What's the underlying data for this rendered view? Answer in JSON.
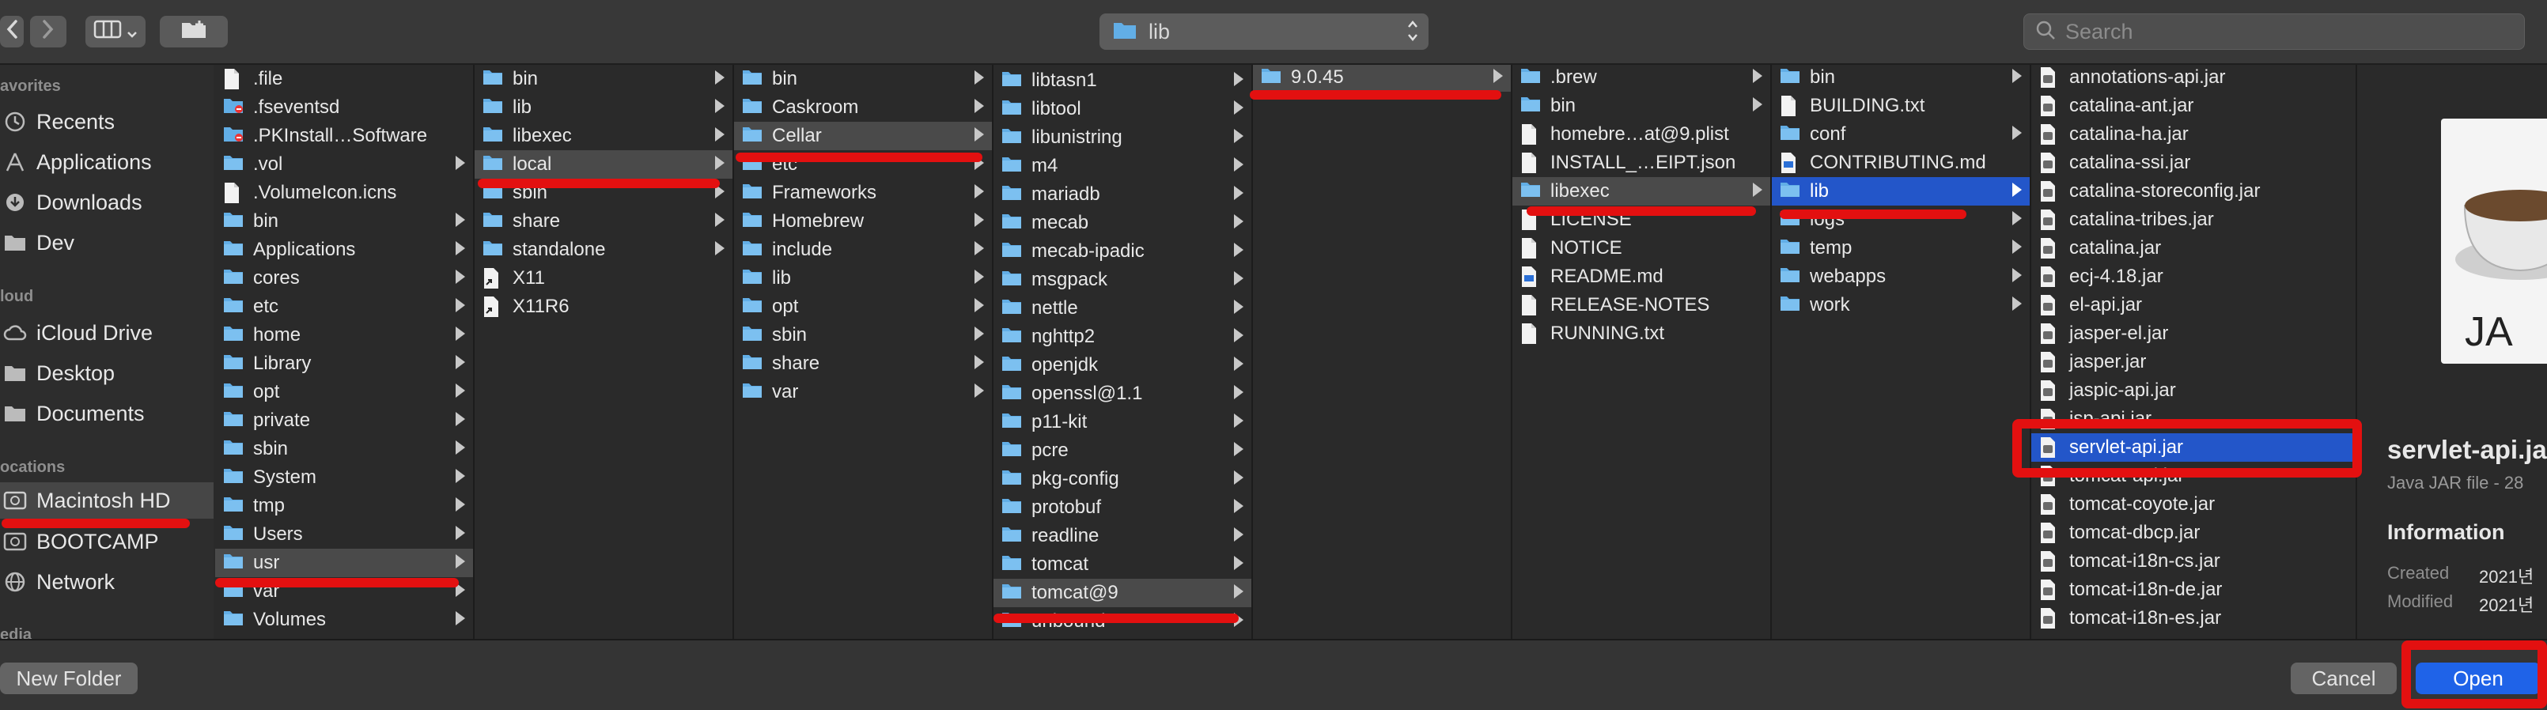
{
  "toolbar": {
    "back_icon": "chevron-left-icon",
    "forward_icon": "chevron-right-icon",
    "view_icon": "column-view-icon",
    "new_folder_icon": "new-folder-icon",
    "path_label": "lib",
    "search_placeholder": "Search"
  },
  "sidebar": {
    "sections": [
      {
        "title": "avorites",
        "items": [
          {
            "label": "Recents",
            "icon": "clock-icon"
          },
          {
            "label": "Applications",
            "icon": "applications-icon"
          },
          {
            "label": "Downloads",
            "icon": "download-icon"
          },
          {
            "label": "Dev",
            "icon": "folder-icon"
          }
        ]
      },
      {
        "title": "loud",
        "items": [
          {
            "label": "iCloud Drive",
            "icon": "cloud-icon"
          },
          {
            "label": "Desktop",
            "icon": "folder-icon"
          },
          {
            "label": "Documents",
            "icon": "document-icon"
          }
        ]
      },
      {
        "title": "ocations",
        "items": [
          {
            "label": "Macintosh HD",
            "icon": "hard-drive-icon",
            "selected": true
          },
          {
            "label": "BOOTCAMP",
            "icon": "hard-drive-icon"
          },
          {
            "label": "Network",
            "icon": "globe-icon"
          }
        ]
      },
      {
        "title": "edia",
        "items": []
      }
    ]
  },
  "columns": [
    {
      "name": "root",
      "items": [
        {
          "label": ".file",
          "type": "file"
        },
        {
          "label": ".fseventsd",
          "type": "folder-restricted"
        },
        {
          "label": ".PKInstall…Software",
          "type": "folder-restricted"
        },
        {
          "label": ".vol",
          "type": "folder",
          "expand": true
        },
        {
          "label": ".VolumeIcon.icns",
          "type": "file"
        },
        {
          "label": "bin",
          "type": "folder",
          "expand": true
        },
        {
          "label": "Applications",
          "type": "folder",
          "expand": true
        },
        {
          "label": "cores",
          "type": "folder",
          "expand": true
        },
        {
          "label": "etc",
          "type": "folder",
          "expand": true
        },
        {
          "label": "home",
          "type": "folder",
          "expand": true
        },
        {
          "label": "Library",
          "type": "folder",
          "expand": true
        },
        {
          "label": "opt",
          "type": "folder",
          "expand": true
        },
        {
          "label": "private",
          "type": "folder",
          "expand": true
        },
        {
          "label": "sbin",
          "type": "folder",
          "expand": true
        },
        {
          "label": "System",
          "type": "folder",
          "expand": true
        },
        {
          "label": "tmp",
          "type": "folder",
          "expand": true
        },
        {
          "label": "Users",
          "type": "folder",
          "expand": true
        },
        {
          "label": "usr",
          "type": "folder",
          "expand": true,
          "state": "gray"
        },
        {
          "label": "var",
          "type": "folder",
          "expand": true
        },
        {
          "label": "Volumes",
          "type": "folder",
          "expand": true
        }
      ]
    },
    {
      "name": "usr",
      "items": [
        {
          "label": "bin",
          "type": "folder",
          "expand": true
        },
        {
          "label": "lib",
          "type": "folder",
          "expand": true
        },
        {
          "label": "libexec",
          "type": "folder",
          "expand": true
        },
        {
          "label": "local",
          "type": "folder",
          "expand": true,
          "state": "gray"
        },
        {
          "label": "sbin",
          "type": "folder",
          "expand": true
        },
        {
          "label": "share",
          "type": "folder",
          "expand": true
        },
        {
          "label": "standalone",
          "type": "folder",
          "expand": true
        },
        {
          "label": "X11",
          "type": "alias"
        },
        {
          "label": "X11R6",
          "type": "alias"
        }
      ]
    },
    {
      "name": "local",
      "items": [
        {
          "label": "bin",
          "type": "folder",
          "expand": true
        },
        {
          "label": "Caskroom",
          "type": "folder",
          "expand": true
        },
        {
          "label": "Cellar",
          "type": "folder",
          "expand": true,
          "state": "gray"
        },
        {
          "label": "etc",
          "type": "folder",
          "expand": true
        },
        {
          "label": "Frameworks",
          "type": "folder",
          "expand": true
        },
        {
          "label": "Homebrew",
          "type": "folder",
          "expand": true
        },
        {
          "label": "include",
          "type": "folder",
          "expand": true
        },
        {
          "label": "lib",
          "type": "folder",
          "expand": true
        },
        {
          "label": "opt",
          "type": "folder",
          "expand": true
        },
        {
          "label": "sbin",
          "type": "folder",
          "expand": true
        },
        {
          "label": "share",
          "type": "folder",
          "expand": true
        },
        {
          "label": "var",
          "type": "folder",
          "expand": true
        }
      ]
    },
    {
      "name": "Cellar",
      "items": [
        {
          "label": "libtasn1",
          "type": "folder",
          "expand": true
        },
        {
          "label": "libtool",
          "type": "folder",
          "expand": true
        },
        {
          "label": "libunistring",
          "type": "folder",
          "expand": true
        },
        {
          "label": "m4",
          "type": "folder",
          "expand": true
        },
        {
          "label": "mariadb",
          "type": "folder",
          "expand": true
        },
        {
          "label": "mecab",
          "type": "folder",
          "expand": true
        },
        {
          "label": "mecab-ipadic",
          "type": "folder",
          "expand": true
        },
        {
          "label": "msgpack",
          "type": "folder",
          "expand": true
        },
        {
          "label": "nettle",
          "type": "folder",
          "expand": true
        },
        {
          "label": "nghttp2",
          "type": "folder",
          "expand": true
        },
        {
          "label": "openjdk",
          "type": "folder",
          "expand": true
        },
        {
          "label": "openssl@1.1",
          "type": "folder",
          "expand": true
        },
        {
          "label": "p11-kit",
          "type": "folder",
          "expand": true
        },
        {
          "label": "pcre",
          "type": "folder",
          "expand": true
        },
        {
          "label": "pkg-config",
          "type": "folder",
          "expand": true
        },
        {
          "label": "protobuf",
          "type": "folder",
          "expand": true
        },
        {
          "label": "readline",
          "type": "folder",
          "expand": true
        },
        {
          "label": "tomcat",
          "type": "folder",
          "expand": true
        },
        {
          "label": "tomcat@9",
          "type": "folder",
          "expand": true,
          "state": "gray"
        },
        {
          "label": "unbound",
          "type": "folder",
          "expand": true
        }
      ]
    },
    {
      "name": "tomcat@9",
      "items": [
        {
          "label": "9.0.45",
          "type": "folder",
          "expand": true,
          "state": "gray"
        }
      ]
    },
    {
      "name": "9.0.45",
      "items": [
        {
          "label": ".brew",
          "type": "folder",
          "expand": true
        },
        {
          "label": "bin",
          "type": "folder",
          "expand": true
        },
        {
          "label": "homebre…at@9.plist",
          "type": "file"
        },
        {
          "label": "INSTALL_…EIPT.json",
          "type": "file"
        },
        {
          "label": "libexec",
          "type": "folder",
          "expand": true,
          "state": "gray"
        },
        {
          "label": "LICENSE",
          "type": "file"
        },
        {
          "label": "NOTICE",
          "type": "file"
        },
        {
          "label": "README.md",
          "type": "file-md"
        },
        {
          "label": "RELEASE-NOTES",
          "type": "file"
        },
        {
          "label": "RUNNING.txt",
          "type": "file"
        }
      ]
    },
    {
      "name": "libexec",
      "items": [
        {
          "label": "bin",
          "type": "folder",
          "expand": true
        },
        {
          "label": "BUILDING.txt",
          "type": "file"
        },
        {
          "label": "conf",
          "type": "folder",
          "expand": true
        },
        {
          "label": "CONTRIBUTING.md",
          "type": "file-md"
        },
        {
          "label": "lib",
          "type": "folder",
          "expand": true,
          "state": "blue"
        },
        {
          "label": "logs",
          "type": "folder",
          "expand": true
        },
        {
          "label": "temp",
          "type": "folder",
          "expand": true
        },
        {
          "label": "webapps",
          "type": "folder",
          "expand": true
        },
        {
          "label": "work",
          "type": "folder",
          "expand": true
        }
      ]
    },
    {
      "name": "lib",
      "items": [
        {
          "label": "annotations-api.jar",
          "type": "jar"
        },
        {
          "label": "catalina-ant.jar",
          "type": "jar"
        },
        {
          "label": "catalina-ha.jar",
          "type": "jar"
        },
        {
          "label": "catalina-ssi.jar",
          "type": "jar"
        },
        {
          "label": "catalina-storeconfig.jar",
          "type": "jar"
        },
        {
          "label": "catalina-tribes.jar",
          "type": "jar"
        },
        {
          "label": "catalina.jar",
          "type": "jar"
        },
        {
          "label": "ecj-4.18.jar",
          "type": "jar"
        },
        {
          "label": "el-api.jar",
          "type": "jar"
        },
        {
          "label": "jasper-el.jar",
          "type": "jar"
        },
        {
          "label": "jasper.jar",
          "type": "jar"
        },
        {
          "label": "jaspic-api.jar",
          "type": "jar"
        },
        {
          "label": "jsp-api.jar",
          "type": "jar"
        },
        {
          "label": "servlet-api.jar",
          "type": "jar",
          "state": "blue"
        },
        {
          "label": "tomcat-api.jar",
          "type": "jar"
        },
        {
          "label": "tomcat-coyote.jar",
          "type": "jar"
        },
        {
          "label": "tomcat-dbcp.jar",
          "type": "jar"
        },
        {
          "label": "tomcat-i18n-cs.jar",
          "type": "jar"
        },
        {
          "label": "tomcat-i18n-de.jar",
          "type": "jar"
        },
        {
          "label": "tomcat-i18n-es.jar",
          "type": "jar"
        }
      ]
    }
  ],
  "preview": {
    "icon": "java-jar-icon",
    "icon_text": "JA",
    "filename": "servlet-api.ja",
    "kind": "Java JAR file - 28",
    "info_heading": "Information",
    "created_label": "Created",
    "created_value": "2021년",
    "modified_label": "Modified",
    "modified_value": "2021년"
  },
  "bottom": {
    "new_folder_label": "New Folder",
    "cancel_label": "Cancel",
    "open_label": "Open"
  },
  "colors": {
    "selection_blue": "#2356c9",
    "open_button": "#1f63e8",
    "annotation_red": "#e31010",
    "folder_blue": "#62aee6"
  }
}
